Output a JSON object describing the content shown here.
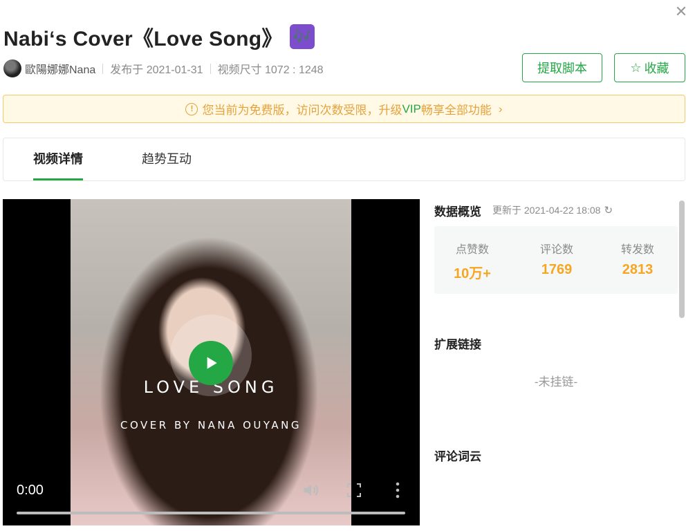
{
  "header": {
    "close_icon": "close-icon",
    "title": "Nabi‘s Cover《Love Song》",
    "title_emoji": "🎶",
    "author": "歐陽娜娜Nana",
    "published": "发布于 2021-01-31",
    "size": "视频尺寸 1072 : 1248"
  },
  "actions": {
    "extract_label": "提取脚本",
    "favorite_label": "收藏",
    "favorite_icon": "star-outline-icon"
  },
  "notice": {
    "text_before": "您当前为免费版，访问次数受限，升级",
    "vip": "VIP",
    "text_after": "畅享全部功能",
    "icon": "warning-circle-icon",
    "chevron": "›"
  },
  "tabs": [
    {
      "label": "视频详情",
      "active": true
    },
    {
      "label": "趋势互动",
      "active": false
    }
  ],
  "video": {
    "overlay_title": "LOVE SONG",
    "overlay_subtitle": "COVER BY NANA OUYANG",
    "time": "0:00",
    "progress": 0,
    "accent": "#23a845"
  },
  "overview": {
    "title": "数据概览",
    "updated": "更新于 2021-04-22 18:08",
    "stats": [
      {
        "label": "点赞数",
        "value": "10万+"
      },
      {
        "label": "评论数",
        "value": "1769"
      },
      {
        "label": "转发数",
        "value": "2813"
      }
    ],
    "value_color": "#f5a623"
  },
  "links": {
    "title": "扩展链接",
    "empty": "-未挂链-"
  },
  "wordcloud": {
    "title": "评论词云"
  }
}
